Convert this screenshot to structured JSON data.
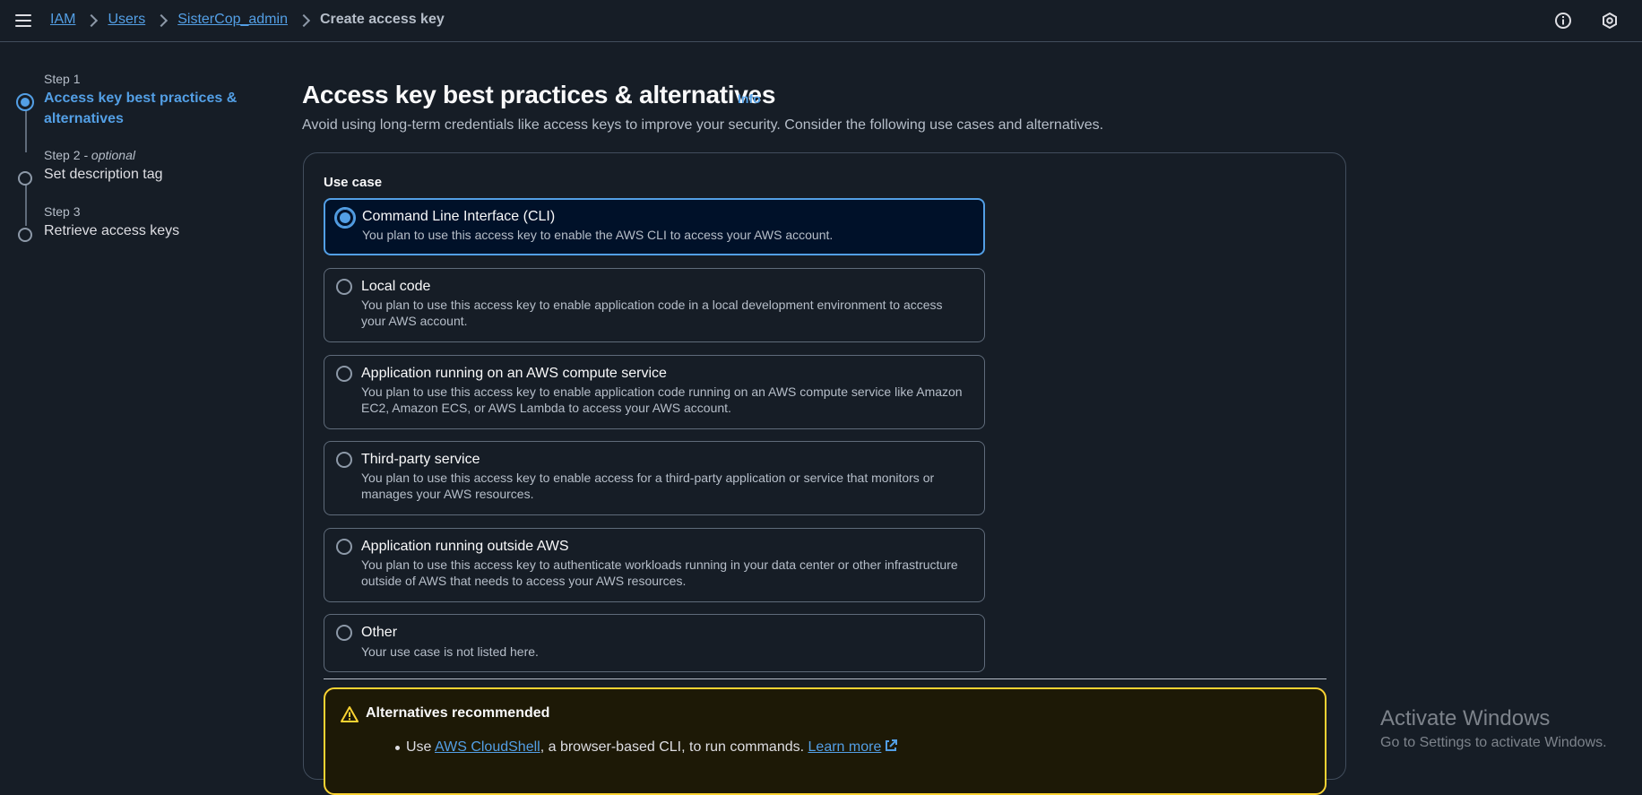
{
  "breadcrumb": {
    "items": [
      "IAM",
      "Users",
      "SisterCop_admin"
    ],
    "current": "Create access key"
  },
  "steps": [
    {
      "label": "Step 1",
      "title": "Access key best practices &",
      "title2": "alternatives"
    },
    {
      "label": "Step 2",
      "label_suffix": "- optional",
      "title": "Set description tag"
    },
    {
      "label": "Step 3",
      "title": "Retrieve access keys"
    }
  ],
  "main": {
    "title": "Access key best practices & alternatives",
    "info": "Info",
    "description": "Avoid using long-term credentials like access keys to improve your security. Consider the following use cases and alternatives.",
    "use_case_label": "Use case",
    "options": [
      {
        "title": "Command Line Interface (CLI)",
        "desc": "You plan to use this access key to enable the AWS CLI to access your AWS account.",
        "selected": true
      },
      {
        "title": "Local code",
        "desc": "You plan to use this access key to enable application code in a local development environment to access your AWS account."
      },
      {
        "title": "Application running on an AWS compute service",
        "desc": "You plan to use this access key to enable application code running on an AWS compute service like Amazon EC2, Amazon ECS, or AWS Lambda to access your AWS account."
      },
      {
        "title": "Third-party service",
        "desc": "You plan to use this access key to enable access for a third-party application or service that monitors or manages your AWS resources."
      },
      {
        "title": "Application running outside AWS",
        "desc": "You plan to use this access key to authenticate workloads running in your data center or other infrastructure outside of AWS that needs to access your AWS resources."
      },
      {
        "title": "Other",
        "desc": "Your use case is not listed here."
      }
    ]
  },
  "alert": {
    "title": "Alternatives recommended",
    "item_prefix": "Use",
    "item_link": "AWS CloudShell",
    "item_text": ", a browser-based CLI, to run commands.",
    "learn_more": "Learn more"
  },
  "watermark": {
    "line1": "Activate Windows",
    "line2": "Go to Settings to activate Windows."
  },
  "colors": {
    "background": "#161d26",
    "accent": "#539fe5",
    "warning": "#fbd332"
  }
}
